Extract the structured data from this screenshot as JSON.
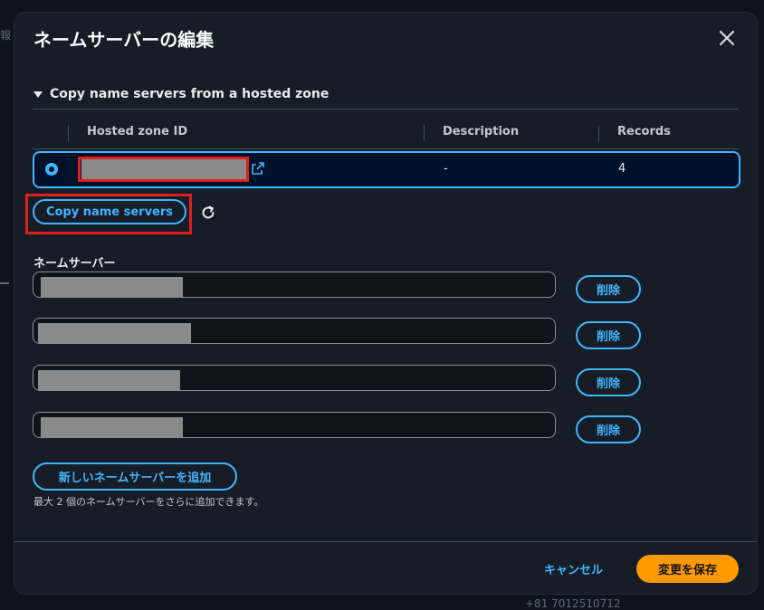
{
  "background": {
    "left_fragment": "報",
    "bottom_right": "+81 7012510712"
  },
  "dialog": {
    "title": "ネームサーバーの編集"
  },
  "section": {
    "label": "Copy name servers from a hosted zone"
  },
  "table": {
    "columns": [
      "Hosted zone ID",
      "Description",
      "Records"
    ],
    "rows": [
      {
        "description": "-",
        "records": "4"
      }
    ]
  },
  "copy_button": "Copy name servers",
  "name_servers": {
    "label": "ネームサーバー",
    "delete_label": "削除",
    "count": 4
  },
  "add_button": "新しいネームサーバーを追加",
  "hint": "最大 2 個のネームサーバーをさらに追加できます。",
  "footer": {
    "cancel": "キャンセル",
    "save": "変更を保存"
  },
  "colors": {
    "accent": "#42b4ff",
    "primary": "#ff9900",
    "highlight": "#e01e1e"
  }
}
